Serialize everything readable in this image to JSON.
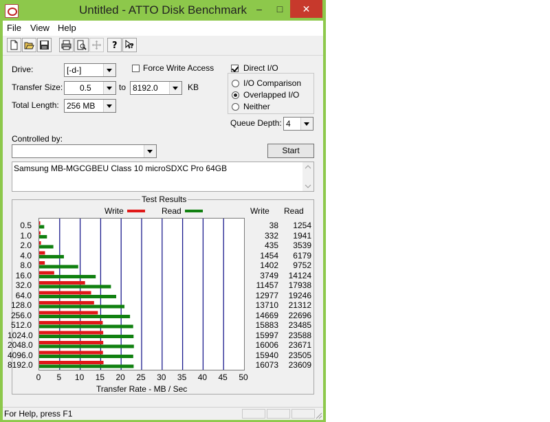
{
  "window": {
    "title": "Untitled - ATTO Disk Benchmark",
    "minimize": "–",
    "maximize": "□",
    "close": "✕"
  },
  "menu": {
    "file": "File",
    "view": "View",
    "help": "Help"
  },
  "toolbar": {
    "icons": [
      "new-icon",
      "open-icon",
      "save-icon",
      "print-icon",
      "print-preview-icon",
      "move-icon",
      "about-icon",
      "context-help-icon"
    ]
  },
  "form": {
    "drive_label": "Drive:",
    "drive_value": "[-d-]",
    "transfer_size_label": "Transfer Size:",
    "transfer_from": "0.5",
    "to_label": "to",
    "transfer_to": "8192.0",
    "kb_label": "KB",
    "total_length_label": "Total Length:",
    "total_length_value": "256 MB",
    "force_write_label": "Force Write Access",
    "force_write_checked": false,
    "direct_io_label": "Direct I/O",
    "direct_io_checked": true,
    "io_comparison_label": "I/O Comparison",
    "overlapped_io_label": "Overlapped I/O",
    "neither_label": "Neither",
    "selected_io_mode": "Overlapped I/O",
    "queue_depth_label": "Queue Depth:",
    "queue_depth_value": "4",
    "controlled_by_label": "Controlled by:",
    "controlled_by_value": "",
    "start_label": "Start",
    "description": "Samsung MB-MGCGBEU Class 10 microSDXC Pro 64GB"
  },
  "results": {
    "title": "Test Results",
    "write_legend": "Write",
    "read_legend": "Read",
    "write_col": "Write",
    "read_col": "Read",
    "write_color": "#e01818",
    "read_color": "#108010",
    "grid_color": "#1a1a8c"
  },
  "chart_data": {
    "type": "bar",
    "orientation": "horizontal",
    "categories": [
      "0.5",
      "1.0",
      "2.0",
      "4.0",
      "8.0",
      "16.0",
      "32.0",
      "64.0",
      "128.0",
      "256.0",
      "512.0",
      "1024.0",
      "2048.0",
      "4096.0",
      "8192.0"
    ],
    "series": [
      {
        "name": "Write",
        "values": [
          38,
          332,
          435,
          1454,
          1402,
          3749,
          11457,
          12977,
          13710,
          14669,
          15883,
          15997,
          16006,
          15940,
          16073
        ]
      },
      {
        "name": "Read",
        "values": [
          1254,
          1941,
          3539,
          6179,
          9752,
          14124,
          17938,
          19246,
          21312,
          22696,
          23485,
          23588,
          23671,
          23505,
          23609
        ]
      }
    ],
    "xlabel": "Transfer Rate - MB / Sec",
    "xlim": [
      0,
      50
    ],
    "xticks": [
      "0",
      "5",
      "10",
      "15",
      "20",
      "25",
      "30",
      "35",
      "40",
      "45",
      "50"
    ],
    "legend": "top",
    "grid": true
  },
  "status": {
    "text": "For Help, press F1"
  }
}
